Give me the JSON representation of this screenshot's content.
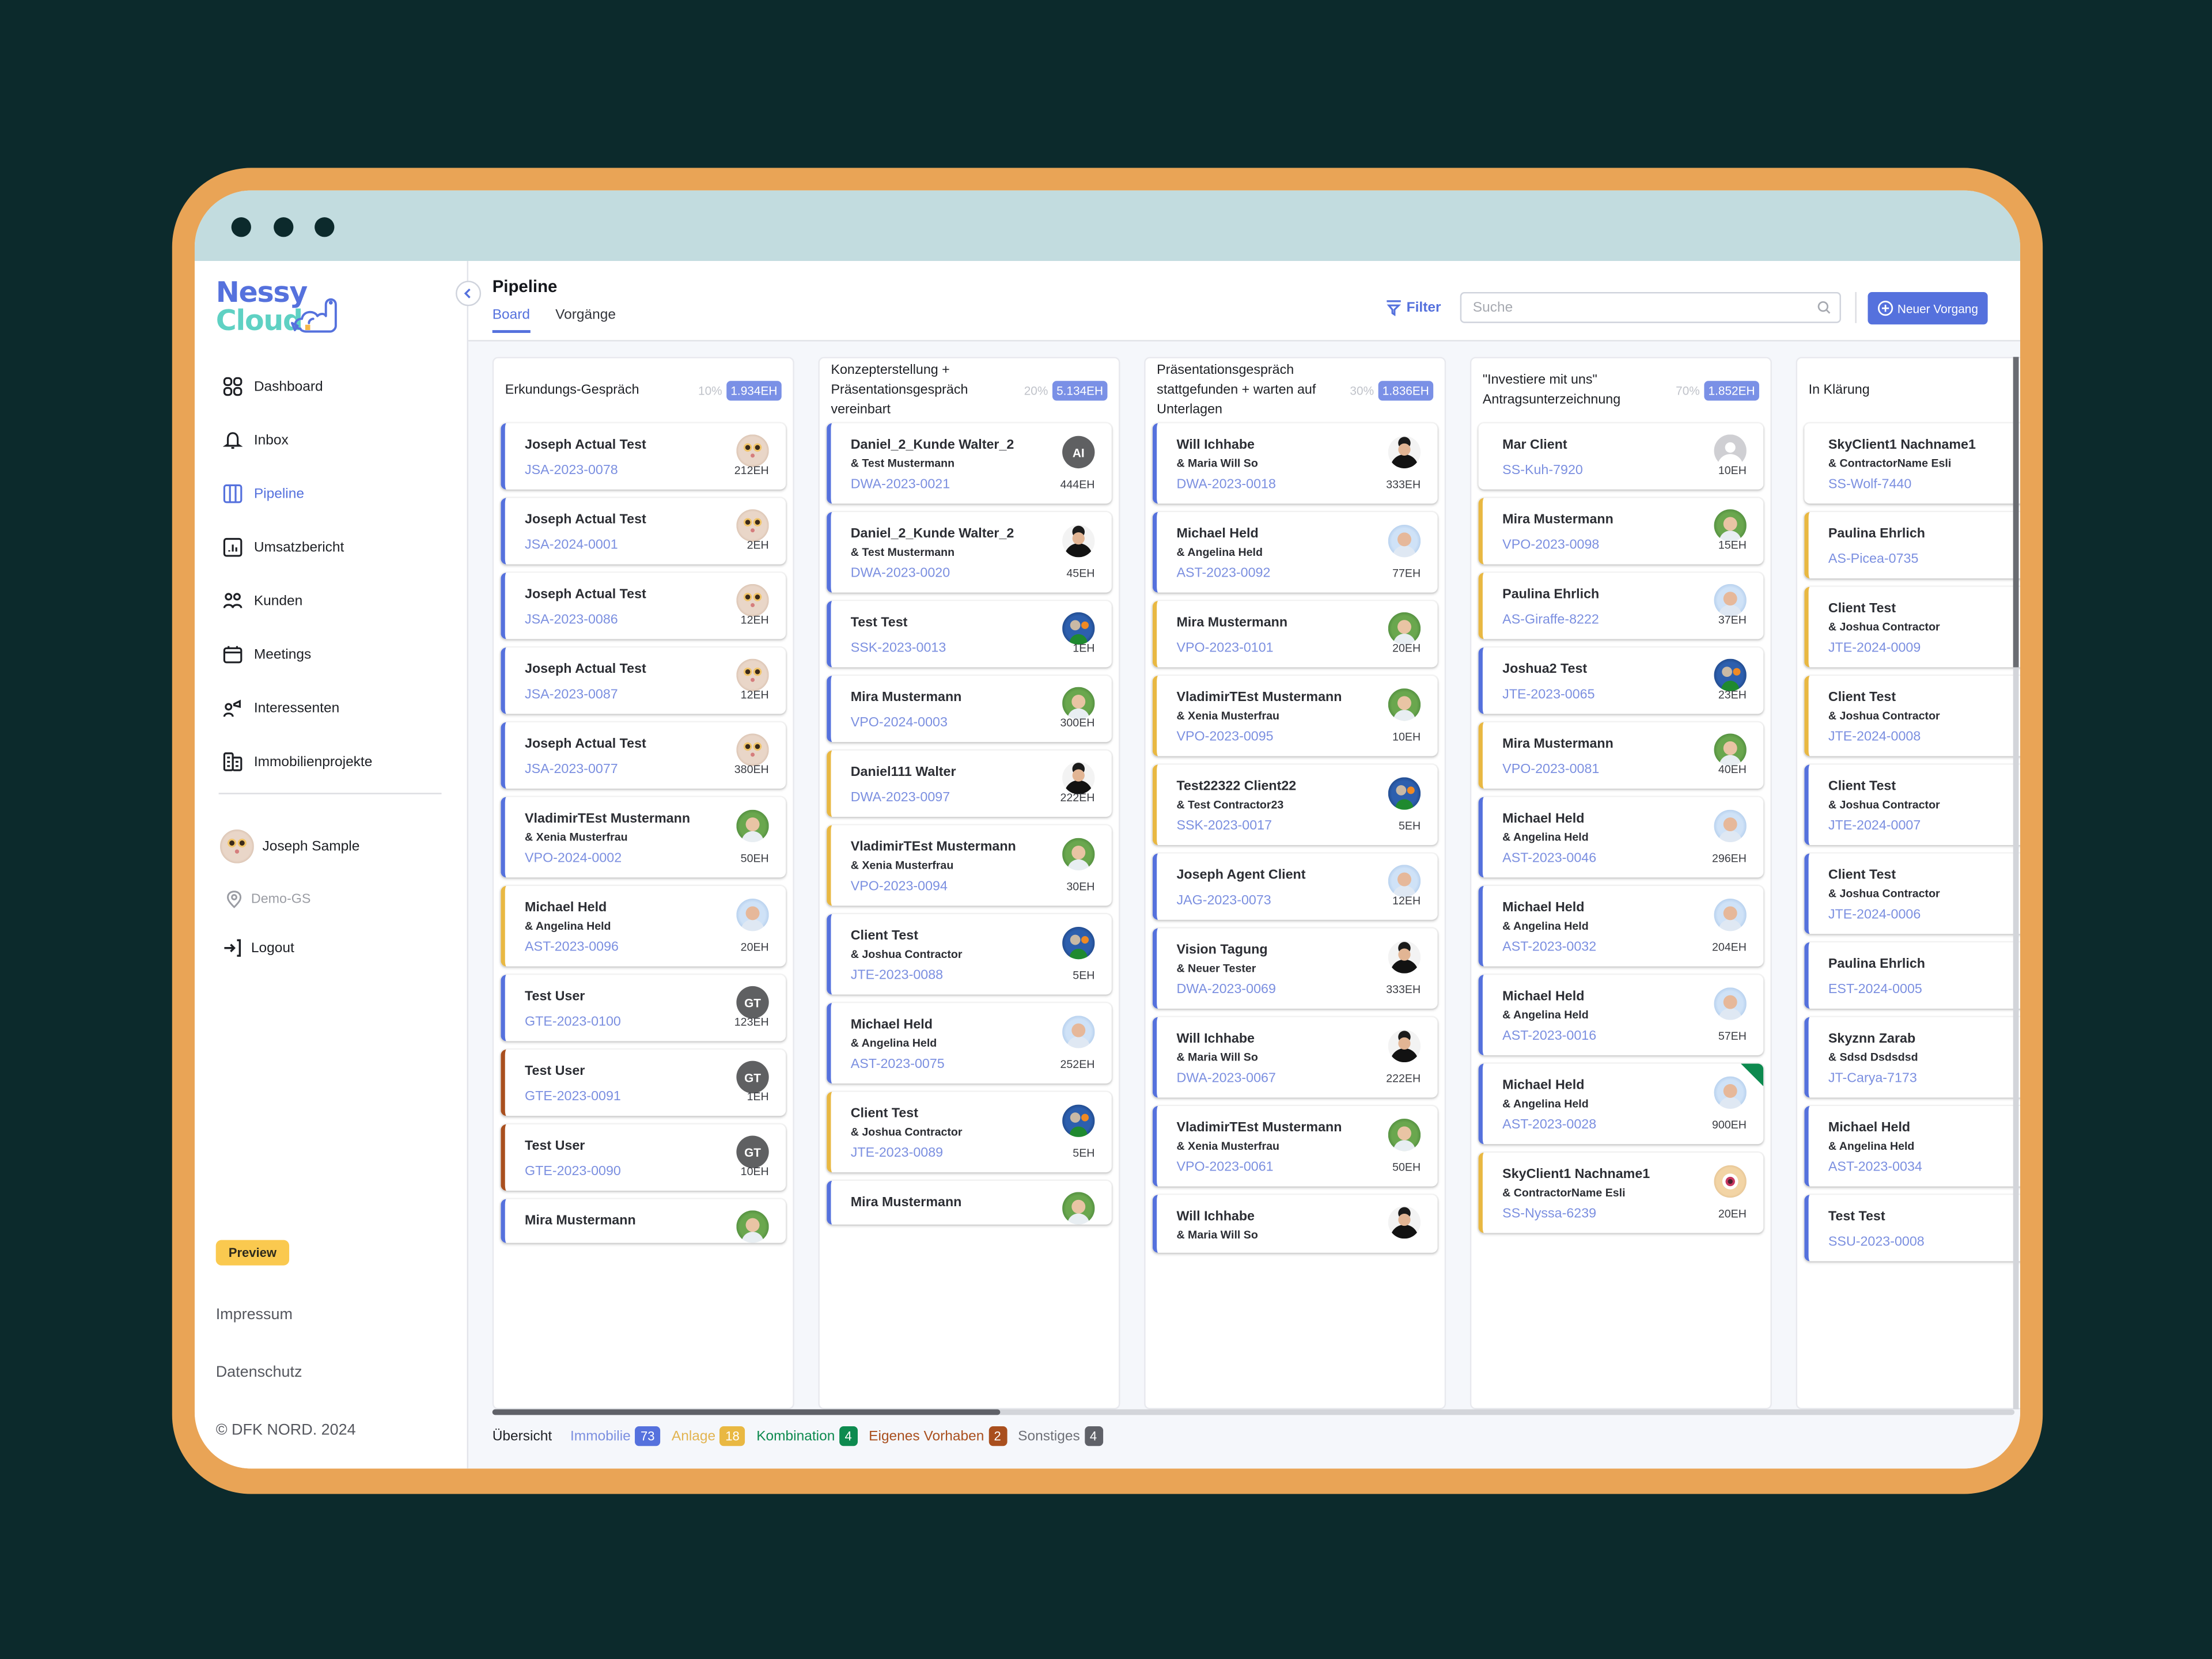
{
  "app": {
    "logo_line1": "Nessy",
    "logo_line2": "Cloud",
    "logo_dot": "."
  },
  "sidebar": {
    "items": [
      {
        "label": "Dashboard",
        "icon": "grid-icon",
        "active": false
      },
      {
        "label": "Inbox",
        "icon": "bell-icon",
        "active": false
      },
      {
        "label": "Pipeline",
        "icon": "columns-icon",
        "active": true
      },
      {
        "label": "Umsatzbericht",
        "icon": "bar-chart-icon",
        "active": false
      },
      {
        "label": "Kunden",
        "icon": "users-icon",
        "active": false
      },
      {
        "label": "Meetings",
        "icon": "calendar-icon",
        "active": false
      },
      {
        "label": "Interessenten",
        "icon": "user-megaphone-icon",
        "active": false
      },
      {
        "label": "Immobilienprojekte",
        "icon": "buildings-icon",
        "active": false
      }
    ],
    "user_name": "Joseph Sample",
    "org_name": "Demo-GS",
    "logout_label": "Logout",
    "preview_badge": "Preview",
    "impressum": "Impressum",
    "datenschutz": "Datenschutz",
    "copyright": "© DFK NORD. 2024"
  },
  "header": {
    "title": "Pipeline",
    "tabs": [
      {
        "label": "Board",
        "active": true
      },
      {
        "label": "Vorgänge",
        "active": false
      }
    ],
    "filter_label": "Filter",
    "search_placeholder": "Suche",
    "search_value": "",
    "new_button_label": "Neuer Vorgang"
  },
  "colors": {
    "accent": "#5571dd",
    "immobilie": "#5571dd",
    "anlage": "#e9b842",
    "kombination": "#0d8a4f",
    "eigenes": "#a94f1e",
    "sonstiges": "#5f6168"
  },
  "columns": [
    {
      "title": "Erkundungs-Gespräch",
      "percent": "10%",
      "sum": "1.934EH",
      "cards": [
        {
          "name": "Joseph Actual Test",
          "partner": "",
          "code": "JSA-2023-0078",
          "eh": "212EH",
          "type": "blue",
          "avatar": "cat"
        },
        {
          "name": "Joseph Actual Test",
          "partner": "",
          "code": "JSA-2024-0001",
          "eh": "2EH",
          "type": "blue",
          "avatar": "cat"
        },
        {
          "name": "Joseph Actual Test",
          "partner": "",
          "code": "JSA-2023-0086",
          "eh": "12EH",
          "type": "blue",
          "avatar": "cat"
        },
        {
          "name": "Joseph Actual Test",
          "partner": "",
          "code": "JSA-2023-0087",
          "eh": "12EH",
          "type": "blue",
          "avatar": "cat"
        },
        {
          "name": "Joseph Actual Test",
          "partner": "",
          "code": "JSA-2023-0077",
          "eh": "380EH",
          "type": "blue",
          "avatar": "cat"
        },
        {
          "name": "VladimirTEst Mustermann",
          "partner": "& Xenia Musterfrau",
          "code": "VPO-2024-0002",
          "eh": "50EH",
          "type": "blue",
          "avatar": "green"
        },
        {
          "name": "Michael Held",
          "partner": "& Angelina Held",
          "code": "AST-2023-0096",
          "eh": "20EH",
          "type": "yellow",
          "avatar": "lightblue"
        },
        {
          "name": "Test User",
          "partner": "",
          "code": "GTE-2023-0100",
          "eh": "123EH",
          "type": "blue",
          "avatar": "initials",
          "initials": "GT"
        },
        {
          "name": "Test User",
          "partner": "",
          "code": "GTE-2023-0091",
          "eh": "1EH",
          "type": "brown",
          "avatar": "initials",
          "initials": "GT"
        },
        {
          "name": "Test User",
          "partner": "",
          "code": "GTE-2023-0090",
          "eh": "10EH",
          "type": "brown",
          "avatar": "initials",
          "initials": "GT"
        },
        {
          "name": "Mira Mustermann",
          "partner": "",
          "code": "",
          "eh": "",
          "type": "blue",
          "avatar": "green"
        }
      ]
    },
    {
      "title": "Konzepterstellung + Präsentationsgespräch vereinbart",
      "percent": "20%",
      "sum": "5.134EH",
      "cards": [
        {
          "name": "Daniel_2_Kunde Walter_2",
          "partner": "& Test Mustermann",
          "code": "DWA-2023-0021",
          "eh": "444EH",
          "type": "blue",
          "avatar": "initials",
          "initials": "AI"
        },
        {
          "name": "Daniel_2_Kunde Walter_2",
          "partner": "& Test Mustermann",
          "code": "DWA-2023-0020",
          "eh": "45EH",
          "type": "blue",
          "avatar": "dark"
        },
        {
          "name": "Test Test",
          "partner": "",
          "code": "SSK-2023-0013",
          "eh": "1EH",
          "type": "blue",
          "avatar": "navy"
        },
        {
          "name": "Mira Mustermann",
          "partner": "",
          "code": "VPO-2024-0003",
          "eh": "300EH",
          "type": "blue",
          "avatar": "green"
        },
        {
          "name": "Daniel111 Walter",
          "partner": "",
          "code": "DWA-2023-0097",
          "eh": "222EH",
          "type": "yellow",
          "avatar": "dark"
        },
        {
          "name": "VladimirTEst Mustermann",
          "partner": "& Xenia Musterfrau",
          "code": "VPO-2023-0094",
          "eh": "30EH",
          "type": "yellow",
          "avatar": "green"
        },
        {
          "name": "Client Test",
          "partner": "& Joshua Contractor",
          "code": "JTE-2023-0088",
          "eh": "5EH",
          "type": "blue",
          "avatar": "navy"
        },
        {
          "name": "Michael Held",
          "partner": "& Angelina Held",
          "code": "AST-2023-0075",
          "eh": "252EH",
          "type": "blue",
          "avatar": "lightblue"
        },
        {
          "name": "Client Test",
          "partner": "& Joshua Contractor",
          "code": "JTE-2023-0089",
          "eh": "5EH",
          "type": "yellow",
          "avatar": "navy"
        },
        {
          "name": "Mira Mustermann",
          "partner": "",
          "code": "",
          "eh": "",
          "type": "blue",
          "avatar": "green"
        }
      ]
    },
    {
      "title": "Präsentationsgespräch stattgefunden + warten auf Unterlagen",
      "percent": "30%",
      "sum": "1.836EH",
      "cards": [
        {
          "name": "Will Ichhabe",
          "partner": "& Maria Will So",
          "code": "DWA-2023-0018",
          "eh": "333EH",
          "type": "blue",
          "avatar": "dark"
        },
        {
          "name": "Michael Held",
          "partner": "& Angelina Held",
          "code": "AST-2023-0092",
          "eh": "77EH",
          "type": "blue",
          "avatar": "lightblue"
        },
        {
          "name": "Mira Mustermann",
          "partner": "",
          "code": "VPO-2023-0101",
          "eh": "20EH",
          "type": "yellow",
          "avatar": "green"
        },
        {
          "name": "VladimirTEst Mustermann",
          "partner": "& Xenia Musterfrau",
          "code": "VPO-2023-0095",
          "eh": "10EH",
          "type": "yellow",
          "avatar": "green"
        },
        {
          "name": "Test22322 Client22",
          "partner": "& Test Contractor23",
          "code": "SSK-2023-0017",
          "eh": "5EH",
          "type": "yellow",
          "avatar": "navy"
        },
        {
          "name": "Joseph Agent Client",
          "partner": "",
          "code": "JAG-2023-0073",
          "eh": "12EH",
          "type": "blue",
          "avatar": "lightblue"
        },
        {
          "name": "Vision Tagung",
          "partner": "& Neuer Tester",
          "code": "DWA-2023-0069",
          "eh": "333EH",
          "type": "blue",
          "avatar": "dark"
        },
        {
          "name": "Will Ichhabe",
          "partner": "& Maria Will So",
          "code": "DWA-2023-0067",
          "eh": "222EH",
          "type": "blue",
          "avatar": "dark"
        },
        {
          "name": "VladimirTEst Mustermann",
          "partner": "& Xenia Musterfrau",
          "code": "VPO-2023-0061",
          "eh": "50EH",
          "type": "blue",
          "avatar": "green"
        },
        {
          "name": "Will Ichhabe",
          "partner": "& Maria Will So",
          "code": "",
          "eh": "",
          "type": "blue",
          "avatar": "dark"
        }
      ]
    },
    {
      "title": "\"Investiere mit uns\" Antragsunterzeichnung",
      "percent": "70%",
      "sum": "1.852EH",
      "cards": [
        {
          "name": "Mar Client",
          "partner": "",
          "code": "SS-Kuh-7920",
          "eh": "10EH",
          "type": "none",
          "avatar": "placeholder"
        },
        {
          "name": "Mira Mustermann",
          "partner": "",
          "code": "VPO-2023-0098",
          "eh": "15EH",
          "type": "yellow",
          "avatar": "green"
        },
        {
          "name": "Paulina Ehrlich",
          "partner": "",
          "code": "AS-Giraffe-8222",
          "eh": "37EH",
          "type": "yellow",
          "avatar": "lightblue"
        },
        {
          "name": "Joshua2 Test",
          "partner": "",
          "code": "JTE-2023-0065",
          "eh": "23EH",
          "type": "blue",
          "avatar": "navy"
        },
        {
          "name": "Mira Mustermann",
          "partner": "",
          "code": "VPO-2023-0081",
          "eh": "40EH",
          "type": "yellow",
          "avatar": "green"
        },
        {
          "name": "Michael Held",
          "partner": "& Angelina Held",
          "code": "AST-2023-0046",
          "eh": "296EH",
          "type": "blue",
          "avatar": "lightblue"
        },
        {
          "name": "Michael Held",
          "partner": "& Angelina Held",
          "code": "AST-2023-0032",
          "eh": "204EH",
          "type": "blue",
          "avatar": "lightblue"
        },
        {
          "name": "Michael Held",
          "partner": "& Angelina Held",
          "code": "AST-2023-0016",
          "eh": "57EH",
          "type": "blue",
          "avatar": "lightblue"
        },
        {
          "name": "Michael Held",
          "partner": "& Angelina Held",
          "code": "AST-2023-0028",
          "eh": "900EH",
          "type": "blue",
          "avatar": "lightblue",
          "flag": true
        },
        {
          "name": "SkyClient1 Nachname1",
          "partner": "& ContractorName Esli",
          "code": "SS-Nyssa-6239",
          "eh": "20EH",
          "type": "yellow",
          "avatar": "eye"
        }
      ]
    },
    {
      "title": "In Klärung",
      "percent": "",
      "sum": "",
      "cards": [
        {
          "name": "SkyClient1 Nachname1",
          "partner": "& ContractorName Esli",
          "code": "SS-Wolf-7440",
          "eh": "",
          "type": "none",
          "avatar": ""
        },
        {
          "name": "Paulina Ehrlich",
          "partner": "",
          "code": "AS-Picea-0735",
          "eh": "",
          "type": "yellow",
          "avatar": ""
        },
        {
          "name": "Client Test",
          "partner": "& Joshua Contractor",
          "code": "JTE-2024-0009",
          "eh": "",
          "type": "yellow",
          "avatar": ""
        },
        {
          "name": "Client Test",
          "partner": "& Joshua Contractor",
          "code": "JTE-2024-0008",
          "eh": "",
          "type": "yellow",
          "avatar": ""
        },
        {
          "name": "Client Test",
          "partner": "& Joshua Contractor",
          "code": "JTE-2024-0007",
          "eh": "",
          "type": "blue",
          "avatar": ""
        },
        {
          "name": "Client Test",
          "partner": "& Joshua Contractor",
          "code": "JTE-2024-0006",
          "eh": "",
          "type": "blue",
          "avatar": ""
        },
        {
          "name": "Paulina Ehrlich",
          "partner": "",
          "code": "EST-2024-0005",
          "eh": "",
          "type": "blue",
          "avatar": ""
        },
        {
          "name": "Skyznn Zarab",
          "partner": "& Sdsd Dsdsdsd",
          "code": "JT-Carya-7173",
          "eh": "",
          "type": "blue",
          "avatar": ""
        },
        {
          "name": "Michael Held",
          "partner": "& Angelina Held",
          "code": "AST-2023-0034",
          "eh": "",
          "type": "blue",
          "avatar": ""
        },
        {
          "name": "Test Test",
          "partner": "",
          "code": "SSU-2023-0008",
          "eh": "",
          "type": "blue",
          "avatar": ""
        }
      ]
    }
  ],
  "legend": {
    "title": "Übersicht",
    "items": [
      {
        "label": "Immobilie",
        "count": "73",
        "color": "#5571dd",
        "text_color": "#7b8fe0"
      },
      {
        "label": "Anlage",
        "count": "18",
        "color": "#e9b842",
        "text_color": "#e2b451"
      },
      {
        "label": "Kombination",
        "count": "4",
        "color": "#0d8a4f",
        "text_color": "#0d8a4f"
      },
      {
        "label": "Eigenes Vorhaben",
        "count": "2",
        "color": "#a94f1e",
        "text_color": "#a94f1e"
      },
      {
        "label": "Sonstiges",
        "count": "4",
        "color": "#5f6168",
        "text_color": "#6e7077"
      }
    ]
  }
}
